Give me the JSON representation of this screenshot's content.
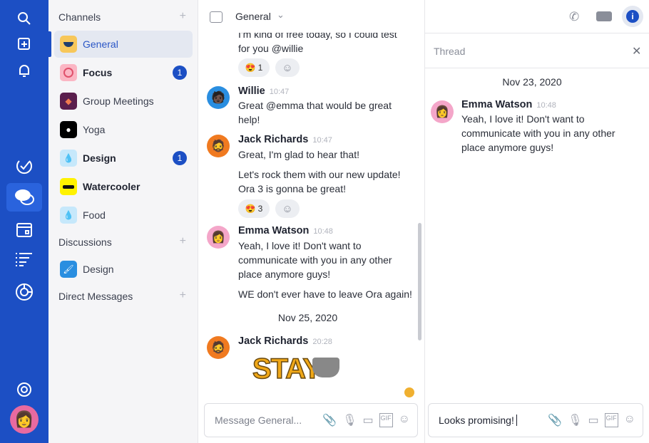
{
  "rail": {
    "items": [
      "search-icon",
      "compose-icon",
      "bell-icon",
      "check-icon",
      "chat-icon",
      "calendar-icon",
      "list-icon",
      "chart-icon",
      "help-icon"
    ],
    "accent": "#1c4fc4"
  },
  "sidebar": {
    "channels_label": "Channels",
    "discussions_label": "Discussions",
    "dm_label": "Direct Messages",
    "channels": [
      {
        "label": "General",
        "selected": true
      },
      {
        "label": "Focus",
        "badge": "1",
        "bold": true
      },
      {
        "label": "Group Meetings"
      },
      {
        "label": "Yoga"
      },
      {
        "label": "Design",
        "badge": "1",
        "bold": true
      },
      {
        "label": "Watercooler",
        "bold": true
      },
      {
        "label": "Food"
      }
    ],
    "discussions": [
      {
        "label": "Design"
      }
    ]
  },
  "chat": {
    "title": "General",
    "messages": [
      {
        "lines": [
          "I'm kind of free today, so I could test",
          "for you @willie"
        ],
        "reaction": {
          "emoji": "😍",
          "count": "1"
        }
      },
      {
        "author": "Willie",
        "time": "10:47",
        "lines": [
          "Great @emma that would be great",
          "help!"
        ]
      },
      {
        "author": "Jack Richards",
        "time": "10:47",
        "lines": [
          "Great, I'm glad to hear that!"
        ],
        "lines2": [
          "Let's rock them with our new update!",
          "Ora 3 is gonna be great!"
        ],
        "reaction": {
          "emoji": "😍",
          "count": "3"
        }
      },
      {
        "author": "Emma Watson",
        "time": "10:48",
        "lines": [
          "Yeah, I love it! Don't want to",
          "communicate with you in any other",
          "place anymore guys!"
        ],
        "lines2": [
          "WE don't ever have to leave Ora again!"
        ]
      },
      {
        "author": "Jack Richards",
        "time": "20:28",
        "sticker": "STAY"
      }
    ],
    "date": "Nov 25, 2020",
    "composer_placeholder": "Message General..."
  },
  "thread": {
    "title": "Thread",
    "date": "Nov 23, 2020",
    "author": "Emma Watson",
    "time": "10:48",
    "lines": [
      "Yeah, I love it! Don't want to",
      "communicate with you in any other",
      "place anymore guys!"
    ],
    "composer_value": "Looks promising!"
  }
}
